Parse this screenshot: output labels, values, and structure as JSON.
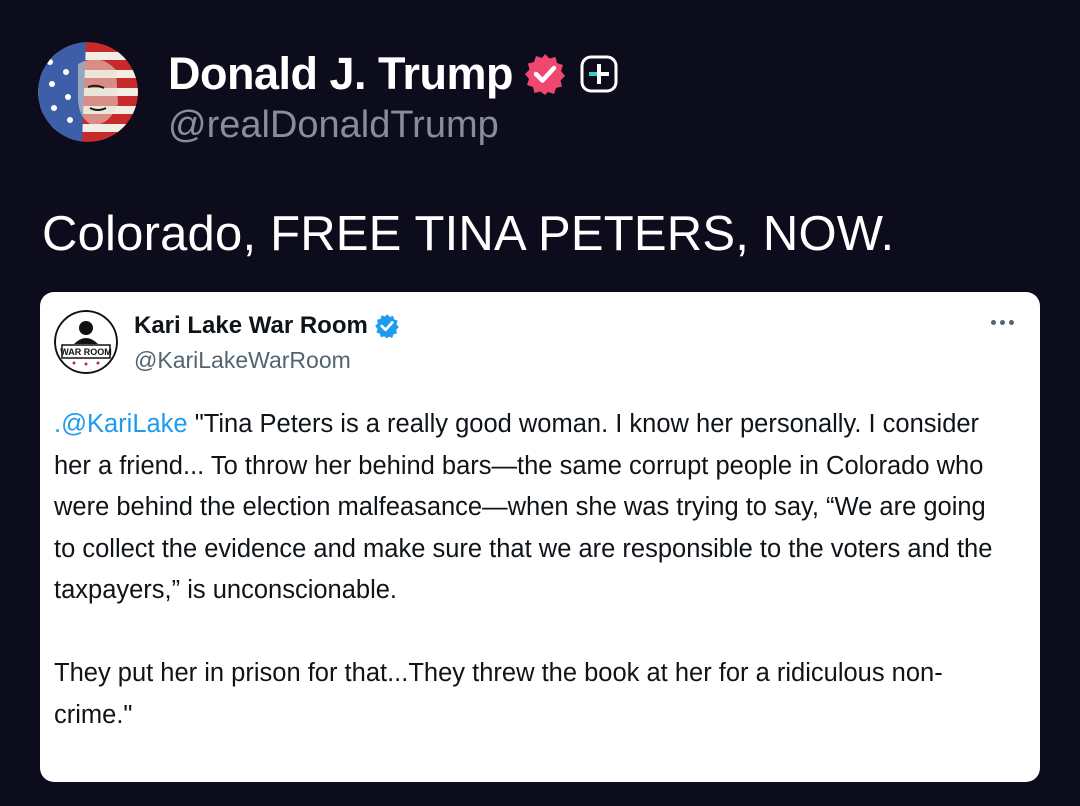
{
  "post": {
    "author": {
      "display_name": "Donald J. Trump",
      "handle": "@realDonaldTrump"
    },
    "text": "Colorado, FREE TINA PETERS, NOW."
  },
  "quoted_post": {
    "author": {
      "display_name": "Kari Lake War Room",
      "handle": "@KariLakeWarRoom",
      "avatar_text": "WAR ROOM"
    },
    "mention": ".@KariLake",
    "body": " \"Tina Peters is a really good woman. I know her personally. I consider her a friend... To throw her behind bars—the same corrupt people in Colorado who were behind the election malfeasance—when she was trying to say, “We are going to collect the evidence and make sure that we are responsible to the voters and the taxpayers,” is unconscionable.\n\nThey put her in prison for that...They threw the book at her for a ridiculous non-crime.\""
  },
  "colors": {
    "background": "#0d0c1c",
    "verified_pink": "#f0476e",
    "verified_blue": "#1d9bf0",
    "mention": "#1d9bf0",
    "handle_gray": "#8a8c98"
  },
  "icons": {
    "verified": "verified-badge-icon",
    "subscribe": "plus-badge-icon",
    "more": "more-options-icon"
  }
}
